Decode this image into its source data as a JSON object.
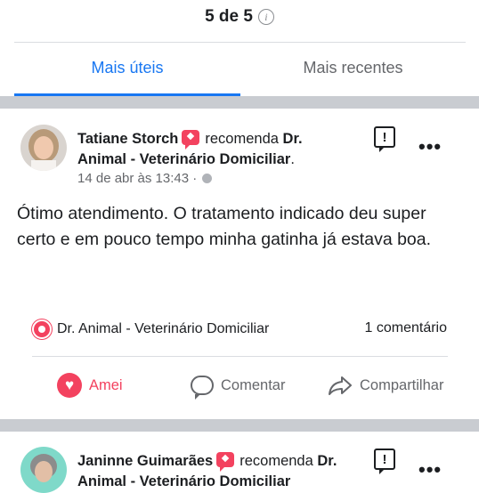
{
  "header": {
    "rating_text": "5 de 5",
    "info_glyph": "i"
  },
  "tabs": [
    {
      "label": "Mais úteis",
      "active": true
    },
    {
      "label": "Mais recentes",
      "active": false
    }
  ],
  "reviews": [
    {
      "author": "Tatiane Storch",
      "verb": "recomenda",
      "page_line1": "Dr.",
      "page_line2": "Animal - Veterinário Domiciliar",
      "page_line2_suffix": ".",
      "date": "14 de abr às 13:43",
      "separator": " · ",
      "text": "Ótimo atendimento. O tratamento indicado deu super certo e em pouco tempo minha gatinha já estava boa.",
      "reaction_page": "Dr. Animal - Veterinário Domiciliar",
      "comments": "1 comentário",
      "actions": {
        "love": "Amei",
        "comment": "Comentar",
        "share": "Compartilhar"
      },
      "report_glyph": "!",
      "more_glyph": "•••"
    },
    {
      "author": "Janinne Guimarães",
      "verb": "recomenda",
      "page_line1": "Dr.",
      "page_line2": "Animal - Veterinário Domiciliar",
      "report_glyph": "!",
      "more_glyph": "•••"
    }
  ],
  "colors": {
    "accent": "#1877f2",
    "love": "#f3425f",
    "separator": "#c9ccd1",
    "secondary_text": "#65676b"
  },
  "icons": [
    "info-icon",
    "recommend-icon",
    "globe-icon",
    "report-icon",
    "more-icon",
    "love-icon",
    "comment-icon",
    "share-icon"
  ]
}
